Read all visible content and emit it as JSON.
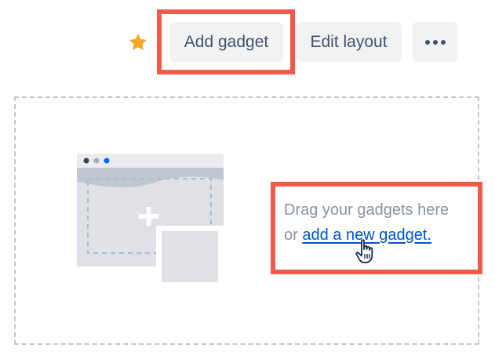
{
  "toolbar": {
    "star_icon": "star-icon",
    "star_color": "#f5a623",
    "add_gadget_label": "Add gadget",
    "edit_layout_label": "Edit layout",
    "more_icon": "more-icon"
  },
  "dropzone": {
    "line1": "Drag your gadgets here",
    "line2_prefix": "or ",
    "link_text": "add a new gadget.",
    "illustration": "dashboard-placeholder-illustration",
    "link_color": "#0052cc"
  },
  "annotations": {
    "highlight_color": "#ef5b4b"
  }
}
